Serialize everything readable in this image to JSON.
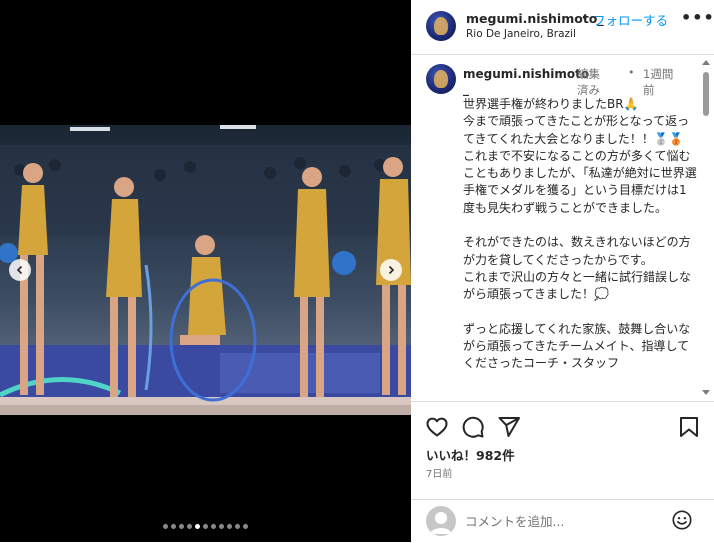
{
  "post": {
    "username": "megumi.nishimoto_",
    "separator": "•",
    "follow_label": "フォローする",
    "more_label": "•••",
    "location": "Rio De Janeiro, Brazil"
  },
  "caption": {
    "username_line1": "megumi.nishimoto",
    "username_line2": "_",
    "edited": "編集済み",
    "separator": "•",
    "time_ago": "1週間前",
    "text": "世界選手権が終わりましたBR🙏\n今まで頑張ってきたことが形となって返ってきてくれた大会となりました！！🥈🥉\nこれまで不安になることの方が多くて悩むこともありましたが、「私達が絶対に世界選手権でメダルを獲る」という目標だけは1度も見失わず戦うことができました。\n\nそれができたのは、数えきれないほどの方が力を貸してくださったからです。\nこれまで沢山の方々と一緒に試行錯誤しながら頑張ってきました！💭\n\nずっと応援してくれた家族、鼓舞し合いながら頑張ってきたチームメイト、指導してくださったコーチ・スタッフ"
  },
  "engagement": {
    "likes": "いいね！982件",
    "posted_ago": "7日前"
  },
  "comment": {
    "placeholder": "コメントを追加..."
  },
  "carousel": {
    "total_slides": 11,
    "active_index": 4,
    "prev_icon": "chevron-left-icon",
    "next_icon": "chevron-right-icon"
  },
  "colors": {
    "link": "#0095f6",
    "text": "#262626",
    "muted": "#737373",
    "border": "#dbdbdb",
    "media_bg": "#000000"
  }
}
